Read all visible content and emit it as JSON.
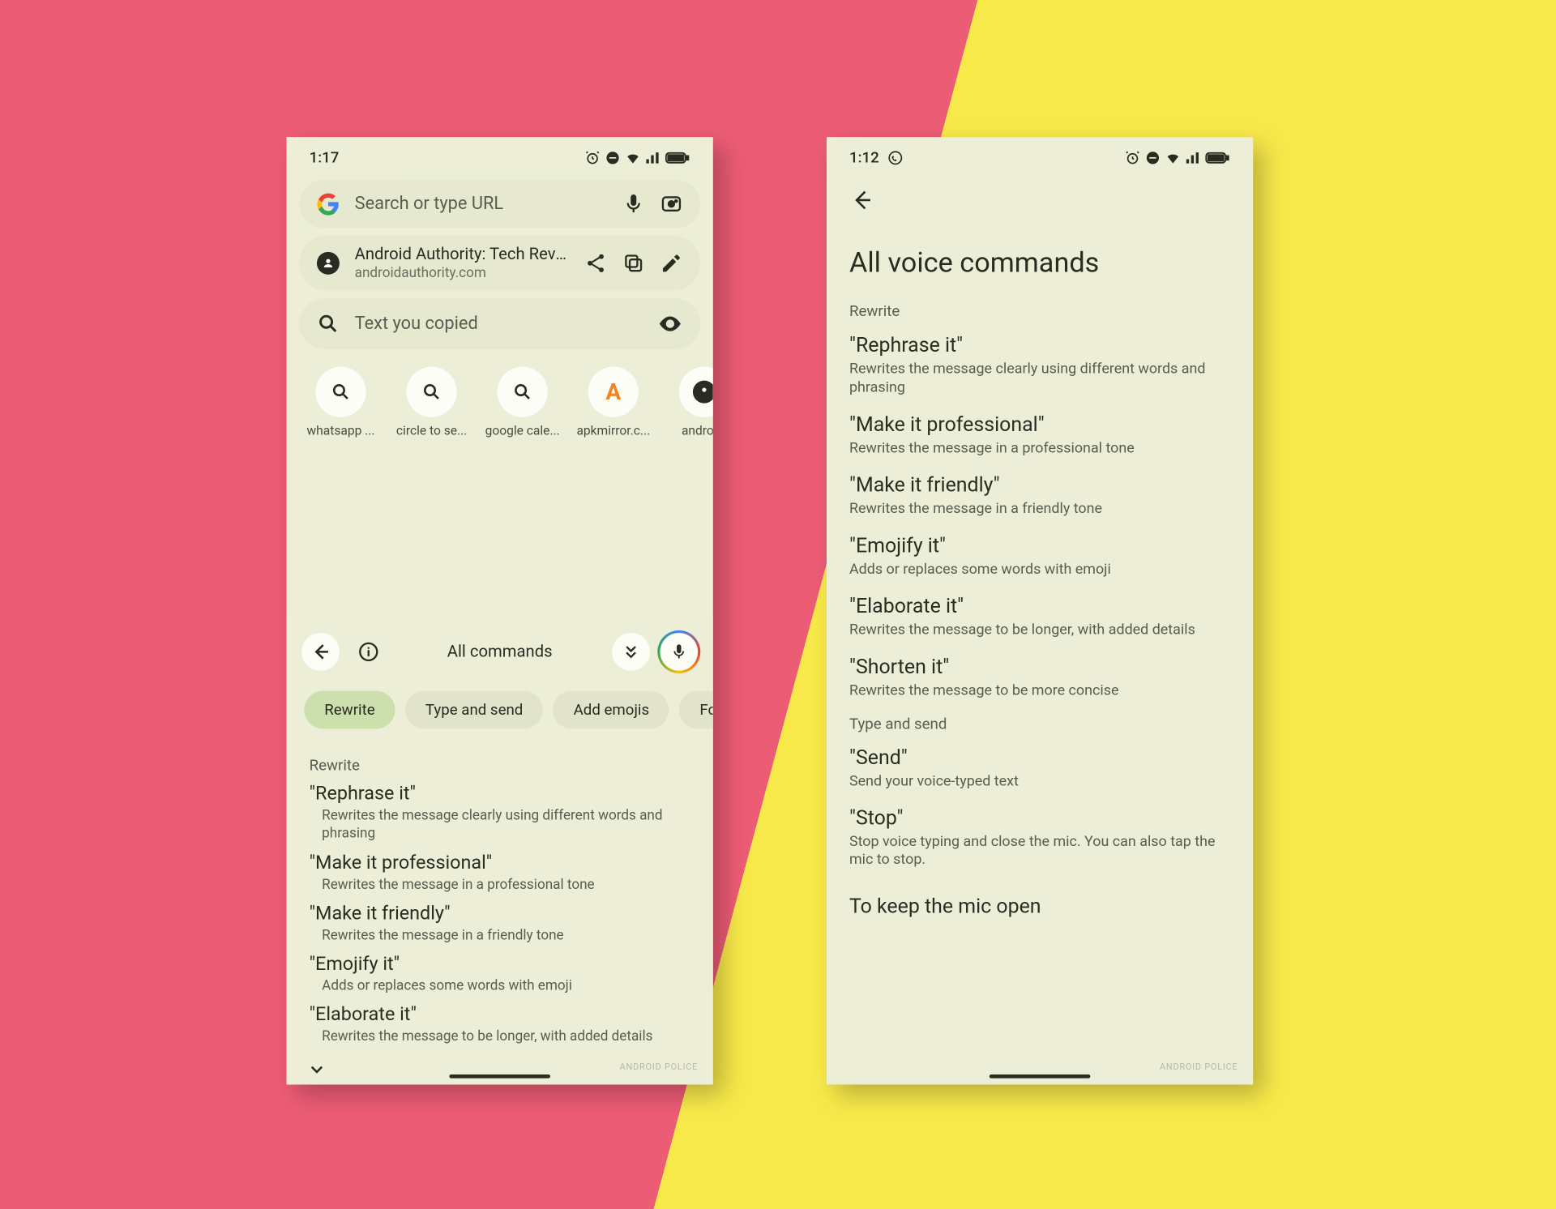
{
  "phone_left": {
    "status": {
      "time": "1:17"
    },
    "search": {
      "placeholder": "Search or type URL"
    },
    "site": {
      "title": "Android Authority: Tech Revie...",
      "url": "androidauthority.com"
    },
    "copied": {
      "label": "Text you copied"
    },
    "shortcuts": [
      {
        "label": "whatsapp ...",
        "icon": "search"
      },
      {
        "label": "circle to se...",
        "icon": "search"
      },
      {
        "label": "google cale...",
        "icon": "search"
      },
      {
        "label": "apkmirror.c...",
        "icon": "apk"
      },
      {
        "label": "androi...",
        "icon": "avatar"
      }
    ],
    "commands": {
      "title": "All commands",
      "chips": [
        {
          "label": "Rewrite",
          "active": true
        },
        {
          "label": "Type and send",
          "active": false
        },
        {
          "label": "Add emojis",
          "active": false
        },
        {
          "label": "Fo",
          "active": false
        }
      ],
      "section": "Rewrite",
      "items": [
        {
          "title": "\"Rephrase it\"",
          "desc": "Rewrites the message clearly using different words and phrasing"
        },
        {
          "title": "\"Make it professional\"",
          "desc": "Rewrites the message in a professional tone"
        },
        {
          "title": "\"Make it friendly\"",
          "desc": "Rewrites the message in a friendly tone"
        },
        {
          "title": "\"Emojify it\"",
          "desc": "Adds or replaces some words with emoji"
        },
        {
          "title": "\"Elaborate it\"",
          "desc": "Rewrites the message to be longer, with added details"
        }
      ]
    },
    "watermark": "ANDROID POLICE"
  },
  "phone_right": {
    "status": {
      "time": "1:12"
    },
    "page_title": "All voice commands",
    "sections": [
      {
        "label": "Rewrite",
        "items": [
          {
            "title": "\"Rephrase it\"",
            "desc": "Rewrites the message clearly using different words and phrasing"
          },
          {
            "title": "\"Make it professional\"",
            "desc": "Rewrites the message in a professional tone"
          },
          {
            "title": "\"Make it friendly\"",
            "desc": "Rewrites the message in a friendly tone"
          },
          {
            "title": "\"Emojify it\"",
            "desc": "Adds or replaces some words with emoji"
          },
          {
            "title": "\"Elaborate it\"",
            "desc": "Rewrites the message to be longer, with added details"
          },
          {
            "title": "\"Shorten it\"",
            "desc": "Rewrites the message to be more concise"
          }
        ]
      },
      {
        "label": "Type and send",
        "items": [
          {
            "title": "\"Send\"",
            "desc": "Send your voice-typed text"
          },
          {
            "title": "\"Stop\"",
            "desc": "Stop voice typing and close the mic. You can also tap the mic to stop."
          }
        ]
      }
    ],
    "footer": "To keep the mic open",
    "watermark": "ANDROID POLICE"
  }
}
